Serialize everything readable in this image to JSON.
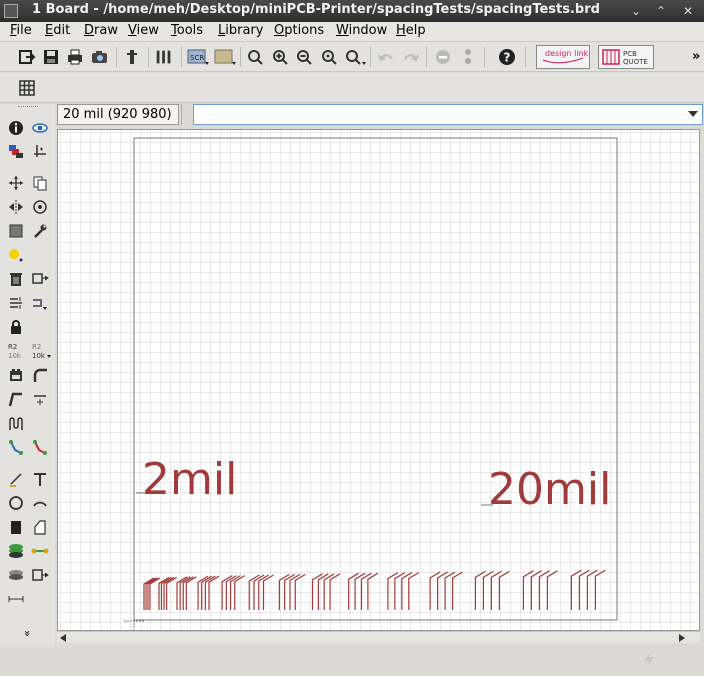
{
  "window": {
    "title": "1 Board - /home/meh/Desktop/miniPCB-Printer/spacingTests/spacingTests.brd",
    "controls": [
      "⌄",
      "⌃",
      "✕"
    ]
  },
  "menu": {
    "items": [
      {
        "key": "F",
        "rest": "ile"
      },
      {
        "key": "E",
        "rest": "dit"
      },
      {
        "key": "D",
        "rest": "raw"
      },
      {
        "key": "V",
        "rest": "iew"
      },
      {
        "key": "T",
        "rest": "ools"
      },
      {
        "key": "L",
        "rest": "ibrary"
      },
      {
        "key": "O",
        "rest": "ptions"
      },
      {
        "key": "W",
        "rest": "indow"
      },
      {
        "key": "H",
        "rest": "elp"
      }
    ]
  },
  "toolbar": {
    "design_link_label": "design link",
    "pcb_quote_label": "PCB QUOTE",
    "scr_label": "SCR",
    "overflow": "»"
  },
  "coords": {
    "value": "20 mil (920 980)"
  },
  "command": {
    "value": "",
    "placeholder": ""
  },
  "palette": {
    "name_label_top": "R2",
    "name_label_bottom": "10k",
    "more": "»"
  },
  "board": {
    "labels": [
      {
        "text": "2mil"
      },
      {
        "text": "20mil"
      }
    ]
  },
  "colors": {
    "trace": "#a33a3a",
    "grid": "#d6d6d6",
    "outline": "#6e6e6e",
    "accent": "#d0205a"
  }
}
